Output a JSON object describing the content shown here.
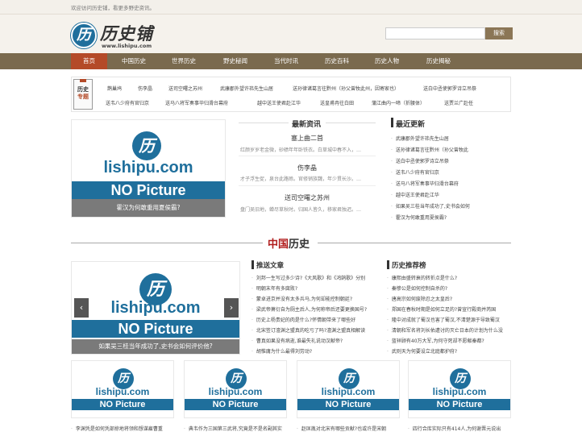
{
  "topbar": {
    "welcome": "欢迎访问历史铺，看更多野史资讯。"
  },
  "logo": {
    "mark": "历",
    "name": "历史铺",
    "url": "www.lishipu.com"
  },
  "search": {
    "placeholder": "",
    "button": "搜索"
  },
  "nav": [
    "首页",
    "中国历史",
    "世界历史",
    "野史秘闻",
    "当代时讯",
    "历史百科",
    "历史人物",
    "历史揭秘"
  ],
  "tagbox": {
    "icon_line1": "历史",
    "icon_line2": "专题",
    "row1": [
      "鹊巢鸠",
      "伤李晶",
      "送司空曙之苏州",
      "武康郡外望许祎先生山居",
      "送孙律诸葛言往黔州（孙父曾牧此州，因寄家也）",
      "送白中丞使郭罗诗立吊祭"
    ],
    "row2": [
      "送韦八少府有官归京",
      "送马八将军奏事毕归滑台幕府",
      "越中送王使君赴江华",
      "送皇甫冉往白田",
      "蒲江曲内一啼（折腰体）",
      "送贾兰广赴任"
    ]
  },
  "placeholder": {
    "circle": "历",
    "brand": "lishipu.com",
    "np": "NO Picture"
  },
  "main_feature": {
    "caption": "霍汉为何敢重用夏侯霸?"
  },
  "latest": {
    "title": "最新资讯",
    "items": [
      {
        "title": "塞上曲二首",
        "desc": "红颜岁岁老金微，砂碛年年卧铁衣。白草城中春不入，…"
      },
      {
        "title": "伤李晶",
        "desc": "才子浮生促，泉台此路赊。官修销族魏，年少贯长沙。…"
      },
      {
        "title": "送司空曙之苏州",
        "desc": "盘门吴旧地，蝉尽草秋时。归国人皆久，移家君独迟。…"
      }
    ]
  },
  "recent": {
    "title": "最近更新",
    "items": [
      "武康郡外望许祎先生山居",
      "送孙律诸葛言往黔州（孙父曾牧此",
      "送白中丞使郭罗诗立吊祭",
      "送韦八少府有官归京",
      "送马八将军奏事毕归滑台幕府",
      "越中送王使君赴江华",
      "如果吴三桂当年成功了,史书会如何",
      "霍汉为何敢重用夏侯霸?"
    ]
  },
  "banner": {
    "part1": "中国",
    "part2": "历史"
  },
  "second_feature": {
    "caption": "如果吴三桂当年成功了,史书会如何评价他?"
  },
  "recommended": {
    "title": "推送文章",
    "items": [
      "刘邦一生写过多少诗?《大风歌》和《鸿鹄歌》分别",
      "明朝末年有多腐败?",
      "蒙卓进京并没有太多兵马,为何却能控制朝廷?",
      "梁武帝萧衍自为厕主后人,为何称帝后还要更换国号?",
      "历史上杨贵妃的肉是什么?怀情朝带来了哪些好",
      "北宋签订澶渊之盟真的吃亏了吗?澶渊之盟真相解读",
      "曹真如果没有病逝,谁最失礼说动汉献帝?",
      "胡惟庸为什么最得刘劳动?"
    ]
  },
  "ranking": {
    "title": "历史推荐榜",
    "items": [
      "康熙由盛转衰的转折点是什么?",
      "秦惨公是如何控制自杀的?",
      "唐高宗如何废除忍之太皇后?",
      "郑国在春秋时期是如何立足的?曾宣行殿商并芮国",
      "隆中对成就了蜀汉也害了蜀汉,不清楚源于导致蜀汉",
      "清朝和军名将刘长佑遭讨的灭亡日本的计划为什么没",
      "蓝祥顾有40万大军,为何守死却不愿献秦都?",
      "武则天为何要设立北庭都护府?"
    ]
  },
  "bottom_captions": [
    "李渊凭是如何凭部掠地将领和想谋雇曹重",
    "典韦作为三国第三武将,究竟是不是名副其实",
    "赵匡胤对北宋有哪些贡献?也或许是宋朝",
    "四行合库实际只有414人,为何谢晋元说出"
  ]
}
